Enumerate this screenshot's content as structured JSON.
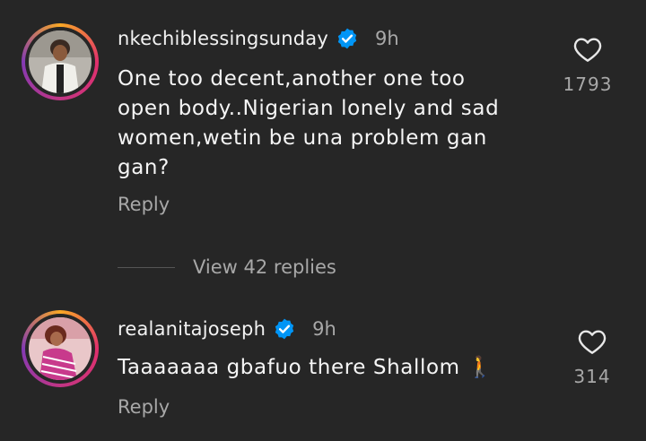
{
  "comments": [
    {
      "username": "nkechiblessingsunday",
      "time": "9h",
      "text_lines": [
        "One too decent,another one too",
        "open body..Nigerian lonely and sad",
        "women,wetin be una problem gan",
        "gan?"
      ],
      "reply_label": "Reply",
      "likes": "1793",
      "verified": true
    },
    {
      "username": "realanitajoseph",
      "time": "9h",
      "text": "Taaaaaaa gbafuo there Shallom 🚶",
      "reply_label": "Reply",
      "likes": "314",
      "verified": true
    }
  ],
  "view_replies": "View 42 replies",
  "colors": {
    "background": "#262626",
    "secondary_text": "#a8a8a8",
    "verified_blue": "#0095f6"
  },
  "icons": [
    "verified-badge-icon",
    "heart-icon",
    "person-walking-emoji"
  ]
}
